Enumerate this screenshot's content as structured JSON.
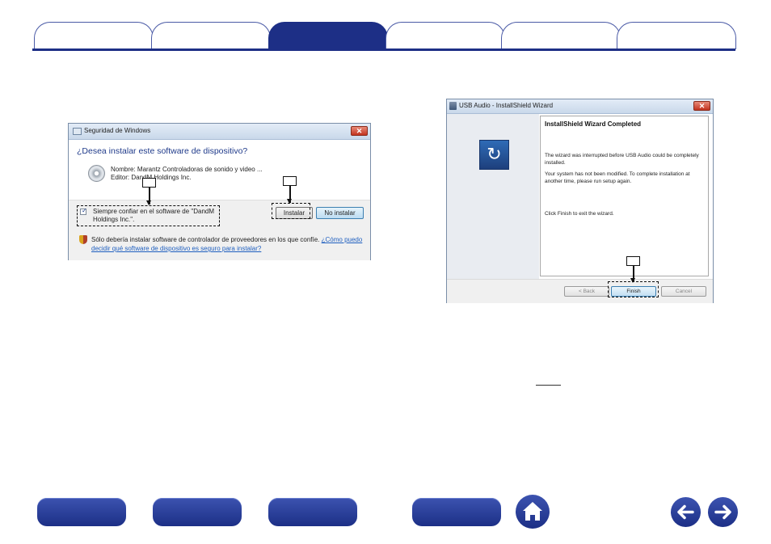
{
  "tabs": [
    {
      "label": "",
      "active": false
    },
    {
      "label": "",
      "active": false
    },
    {
      "label": "",
      "active": true
    },
    {
      "label": "",
      "active": false
    },
    {
      "label": "",
      "active": false
    },
    {
      "label": "",
      "active": false
    }
  ],
  "security_dialog": {
    "title": "Seguridad de Windows",
    "close_glyph": "✕",
    "question": "¿Desea instalar este software de dispositivo?",
    "name_line": "Nombre: Marantz Controladoras de sonido y video ...",
    "editor_line": "Editor: DandM Holdings Inc.",
    "checkbox_checked": true,
    "checkbox_label": "Siempre confiar en el software de \"DandM Holdings Inc.\".",
    "install_button": "Instalar",
    "dont_install_button": "No instalar",
    "warning_text": "Sólo debería instalar software de controlador de proveedores en los que confíe. ",
    "warning_link": "¿Cómo puedo decidir qué software de dispositivo es seguro para instalar?"
  },
  "wizard_dialog": {
    "title": "USB Audio - InstallShield Wizard",
    "close_glyph": "✕",
    "heading": "InstallShield Wizard Completed",
    "paragraph1": "The wizard was interrupted before USB Audio could be completely installed.",
    "paragraph2": "Your system has not been modified. To complete installation at another time, please run setup again.",
    "paragraph3": "Click Finish to exit the wizard.",
    "back_button": "< Back",
    "finish_button": "Finish",
    "cancel_button": "Cancel"
  },
  "bottom_nav": {
    "buttons": [
      "",
      "",
      "",
      ""
    ],
    "home_icon": "home-icon",
    "back_icon": "arrow-left-icon",
    "forward_icon": "arrow-right-icon"
  },
  "colors": {
    "brand_blue": "#1d2f86",
    "link_blue": "#1f5fbf"
  }
}
